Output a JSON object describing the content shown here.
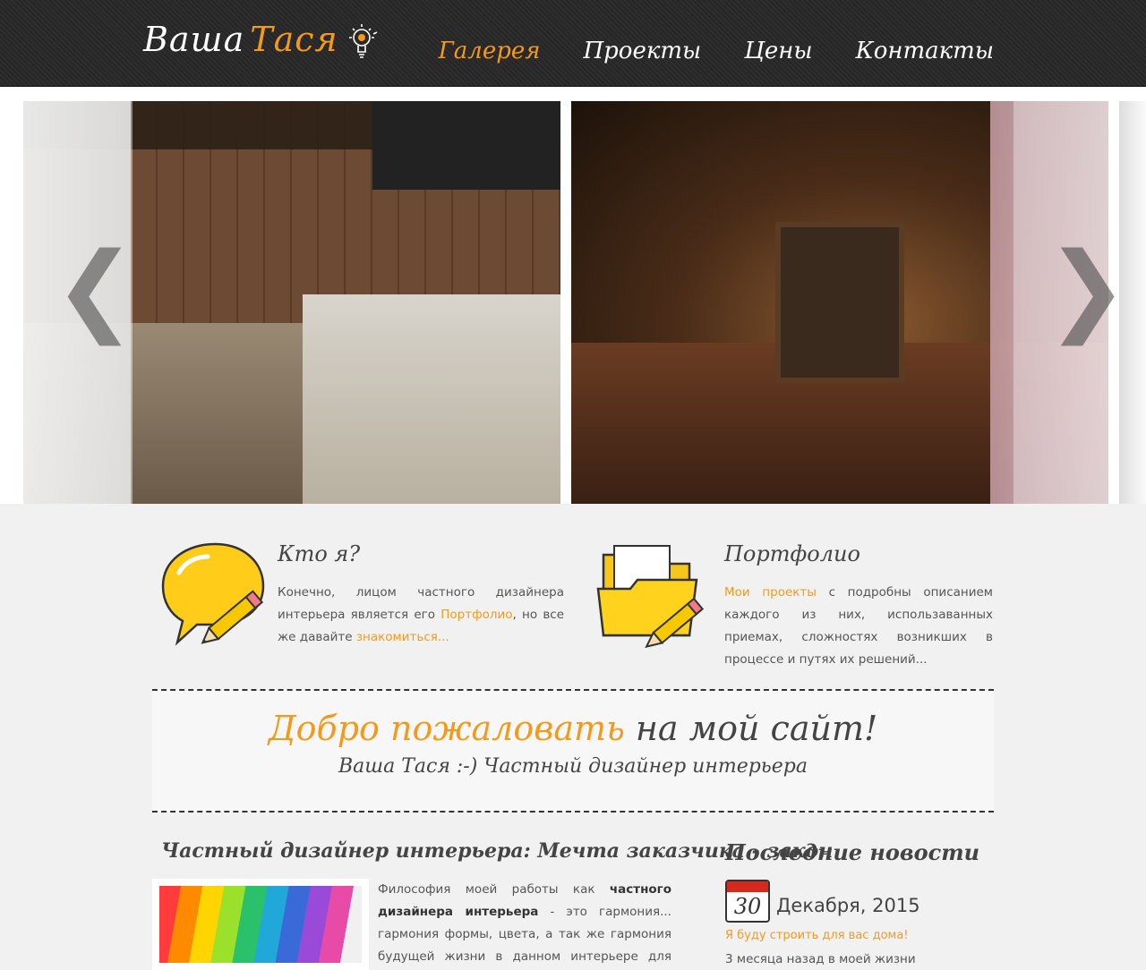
{
  "header": {
    "logo_main": "Ваша",
    "logo_accent": "Тася",
    "nav": [
      {
        "label": "Галерея",
        "active": true
      },
      {
        "label": "Проекты",
        "active": false
      },
      {
        "label": "Цены",
        "active": false
      },
      {
        "label": "Контакты",
        "active": false
      }
    ]
  },
  "slider": {
    "prev_icon": "❮",
    "next_icon": "❯"
  },
  "info": [
    {
      "title": "Кто я?",
      "text_before": "Конечно, лицом частного дизайнера интерьера является его ",
      "link1": "Портфолио",
      "text_middle": ", но все же давайте ",
      "link2": "знакомиться..."
    },
    {
      "title": "Портфолио",
      "link": "Мои проекты",
      "text_after": " с подробны описанием каждого из них, использаванных приемах, сложностях возникших в процессе и путях их решений..."
    }
  ],
  "welcome": {
    "highlight": "Добро пожаловать",
    "rest": " на мой сайт!",
    "subtitle": "Ваша Тася :-) Частный дизайнер интерьера"
  },
  "article": {
    "title": "Частный дизайнер интерьера: Мечта заказчика - закон",
    "text_before": "Философия моей работы как ",
    "bold": "частного дизайнера интерьера",
    "text_after": " - это гармония... гармония формы, цвета, а так же гармония будущей жизни в данном интерьере для конкретного человека, семьи... Кто-"
  },
  "news": {
    "title": "Последние новости",
    "day": "30",
    "date": "Декабря, 2015",
    "headline": "Я буду строить для вас дома!",
    "text": "3 месяца назад в моей жизни"
  },
  "colors": {
    "accent": "#f39a1d",
    "header_bg": "#2a2a2a",
    "page_bg": "#f1f1f1"
  }
}
